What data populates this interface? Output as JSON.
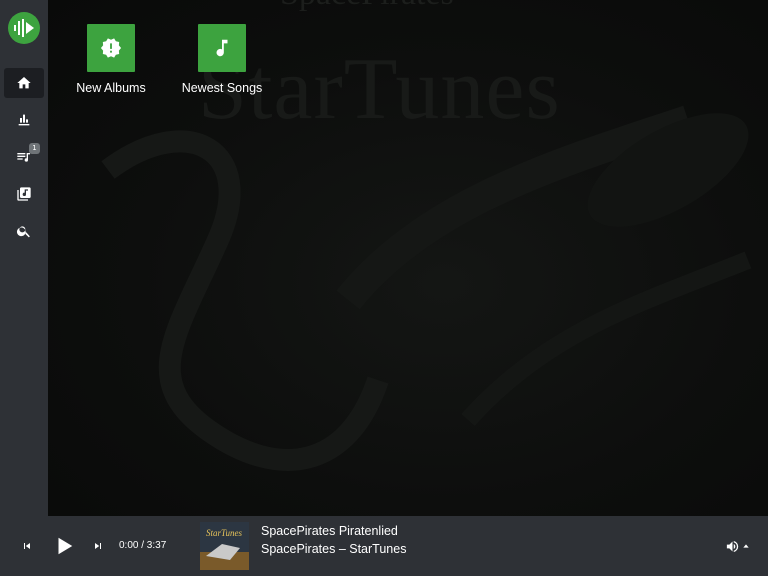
{
  "app": {
    "logo_icon": "waveform-play-icon",
    "accent": "#3da33f"
  },
  "sidebar": {
    "items": [
      {
        "icon": "home-icon",
        "active": true
      },
      {
        "icon": "stats-icon",
        "active": false
      },
      {
        "icon": "queue-icon",
        "active": false,
        "badge": "1"
      },
      {
        "icon": "library-icon",
        "active": false
      },
      {
        "icon": "search-icon",
        "active": false
      }
    ]
  },
  "main": {
    "background_title": "StarTunes",
    "background_subtitle": "SpacePirates",
    "tiles": [
      {
        "label": "New Albums",
        "icon": "new-badge-icon"
      },
      {
        "label": "Newest Songs",
        "icon": "music-note-icon"
      }
    ]
  },
  "player": {
    "time": "0:00 / 3:37",
    "track": {
      "title": "SpacePirates Piratenlied",
      "artist_album": "SpacePirates – StarTunes",
      "cover_title": "StarTunes"
    }
  }
}
